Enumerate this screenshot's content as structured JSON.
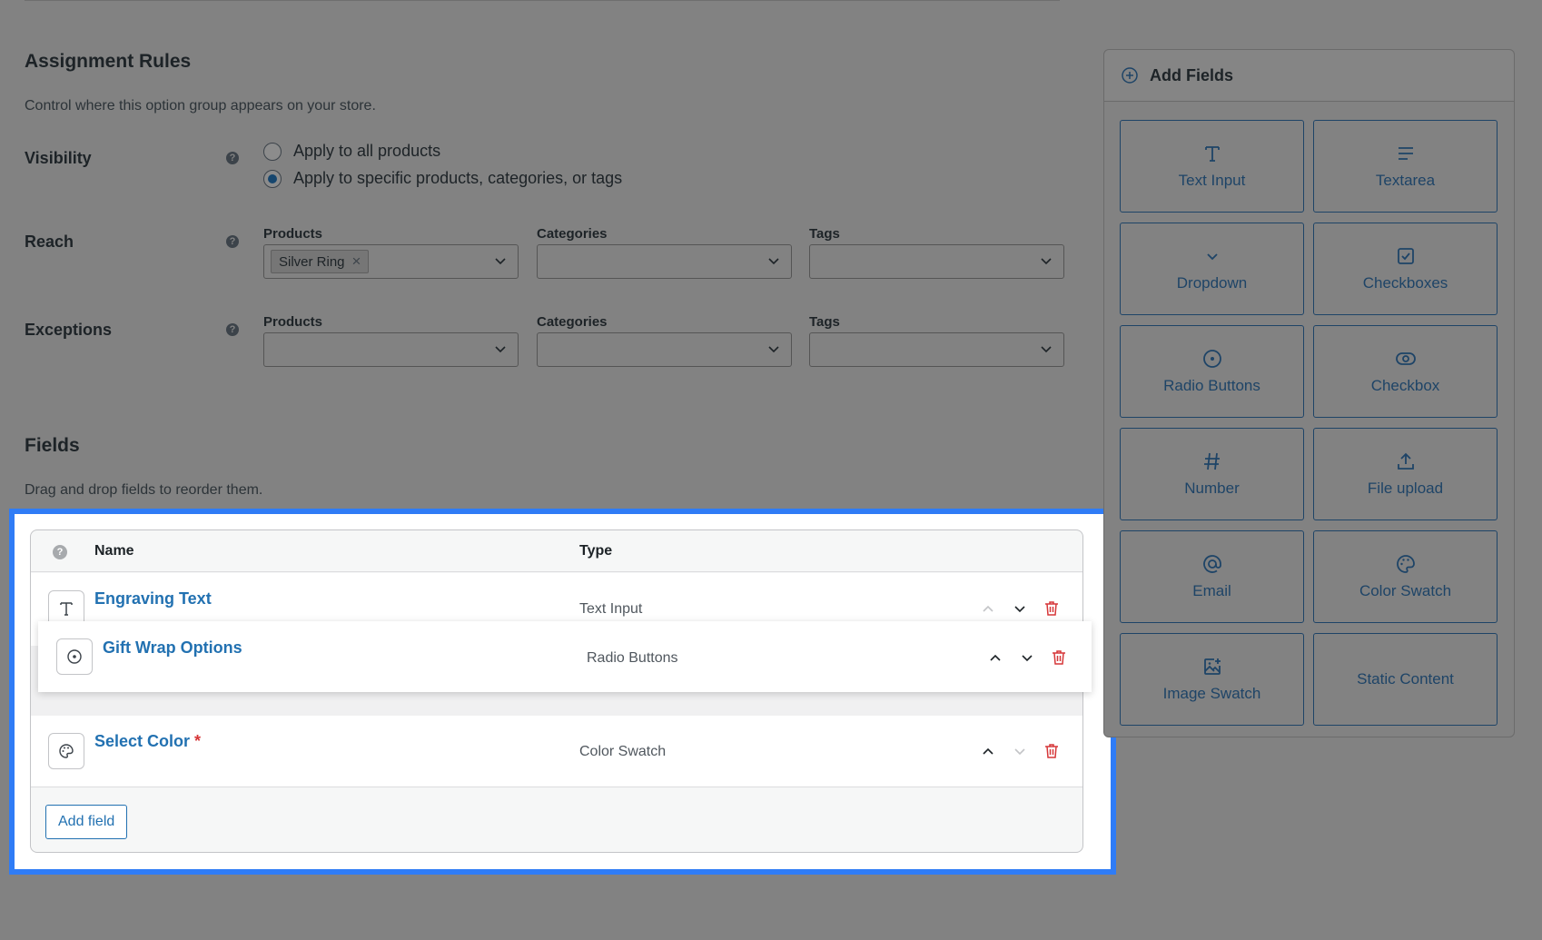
{
  "assignment": {
    "title": "Assignment Rules",
    "description": "Control where this option group appears on your store.",
    "help_glyph": "?",
    "visibility": {
      "label": "Visibility",
      "options": [
        "Apply to all products",
        "Apply to specific products, categories, or tags"
      ],
      "selected": 1
    },
    "reach": {
      "label": "Reach",
      "products_label": "Products",
      "categories_label": "Categories",
      "tags_label": "Tags",
      "products_chip": "Silver Ring",
      "chip_remove": "×"
    },
    "exceptions": {
      "label": "Exceptions",
      "products_label": "Products",
      "categories_label": "Categories",
      "tags_label": "Tags"
    }
  },
  "fields_section": {
    "title": "Fields",
    "description": "Drag and drop fields to reorder them.",
    "columns": {
      "name": "Name",
      "type": "Type"
    },
    "rows": [
      {
        "name": "Engraving Text",
        "type": "Text Input",
        "icon": "text-icon",
        "required": false
      },
      {
        "name": "Gift Wrap Options",
        "type": "Radio Buttons",
        "icon": "radio-icon",
        "required": false,
        "dragging": true
      },
      {
        "name": "Select Color",
        "type": "Color Swatch",
        "icon": "palette-icon",
        "required": true
      }
    ],
    "required_mark": "*",
    "add_button": "Add field"
  },
  "add_fields": {
    "title": "Add Fields",
    "tiles": [
      {
        "label": "Text Input",
        "icon": "text-icon"
      },
      {
        "label": "Textarea",
        "icon": "textarea-icon"
      },
      {
        "label": "Dropdown",
        "icon": "chevron-down-icon"
      },
      {
        "label": "Checkboxes",
        "icon": "checkbox-square-icon"
      },
      {
        "label": "Radio Buttons",
        "icon": "radio-icon"
      },
      {
        "label": "Checkbox",
        "icon": "toggle-icon"
      },
      {
        "label": "Number",
        "icon": "hash-icon"
      },
      {
        "label": "File upload",
        "icon": "upload-icon"
      },
      {
        "label": "Email",
        "icon": "at-icon"
      },
      {
        "label": "Color Swatch",
        "icon": "palette-icon"
      },
      {
        "label": "Image Swatch",
        "icon": "image-add-icon"
      },
      {
        "label": "Static Content",
        "icon": ""
      }
    ]
  },
  "colors": {
    "accent": "#2271b1",
    "highlight_border": "#2f7cf6",
    "delete": "#d63638",
    "overlay": "#828282"
  }
}
